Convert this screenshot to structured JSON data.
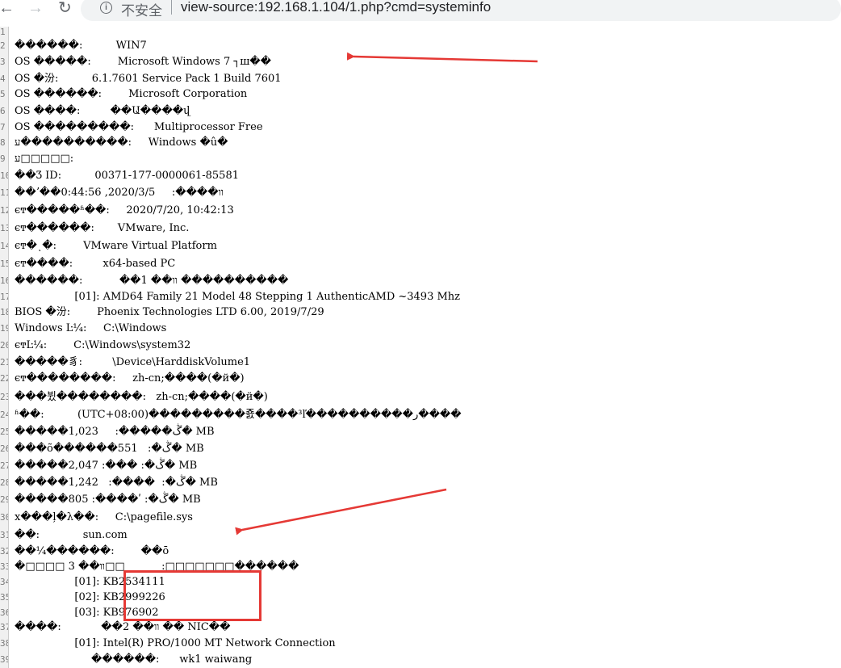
{
  "browser": {
    "back_icon": "back-arrow-icon",
    "forward_icon": "forward-arrow-icon",
    "reload_icon": "reload-icon",
    "security_icon": "info-icon",
    "security_label": "不安全",
    "url": "view-source:192.168.1.104/1.php?cmd=systeminfo"
  },
  "source_lines": [
    {
      "n": "1",
      "text": ""
    },
    {
      "n": "2",
      "text": "������:          WIN7"
    },
    {
      "n": "3",
      "text": "OS �����:        Microsoft Windows 7 ┐ш��"
    },
    {
      "n": "4",
      "text": "OS �汾:          6.1.7601 Service Pack 1 Build 7601"
    },
    {
      "n": "5",
      "text": "OS ������:        Microsoft Corporation"
    },
    {
      "n": "6",
      "text": "OS ����:         ��Ա����վ"
    },
    {
      "n": "7",
      "text": "OS ���������:      Multiprocessor Free"
    },
    {
      "n": "8",
      "text": "ע����������:     Windows �û�"
    },
    {
      "n": "9",
      "text": "ע□□□□□:"
    },
    {
      "n": "10",
      "text": "��Ʒ ID:          00371-177-0000061-85581"
    },
    {
      "n": "11",
      "text": "��ʼ��0:44:56 ,2020/3/5     :����װ"
    },
    {
      "n": "12",
      "text": "ϵͳ�����ʱ��:     2020/7/20, 10:42:13"
    },
    {
      "n": "13",
      "text": "ϵͳ������:       VMware, Inc."
    },
    {
      "n": "14",
      "text": "ϵͳ�ͺ�:        VMware Virtual Platform"
    },
    {
      "n": "15",
      "text": "ϵͳ����:         x64-based PC"
    },
    {
      "n": "16",
      "text": "������:           ��1 ��װ ����������"
    },
    {
      "n": "17",
      "text": "                  [01]: AMD64 Family 21 Model 48 Stepping 1 AuthenticAMD ~3493 Mhz"
    },
    {
      "n": "18",
      "text": "BIOS �汾:        Phoenix Technologies LTD 6.00, 2019/7/29"
    },
    {
      "n": "19",
      "text": "Windows Ŀ¼:     C:\\Windows"
    },
    {
      "n": "20",
      "text": "ϵͳĿ¼:        C:\\Windows\\system32"
    },
    {
      "n": "21",
      "text": "�����豸:         \\Device\\HarddiskVolume1"
    },
    {
      "n": "22",
      "text": "ϵͳ��������:     zh-cn;����(�й�)"
    },
    {
      "n": "23",
      "text": "���뷨��������:   zh-cn;����(�й�)"
    },
    {
      "n": "24",
      "text": "ʱ��:          (UTC+08:00)���������죬����³ľ����������ر����"
    },
    {
      "n": "25",
      "text": "�����1,023     :�����ڴ� MB"
    },
    {
      "n": "26",
      "text": "���õ������551   :�ڴ� MB"
    },
    {
      "n": "27",
      "text": "�����2,047 :��� :�ڴ� MB"
    },
    {
      "n": "28",
      "text": "�����1,242   :����  :�ڴ� MB"
    },
    {
      "n": "29",
      "text": "�����805 :����ʹ :�ڴ� MB"
    },
    {
      "n": "30",
      "text": "x���ļ�λ��:     C:\\pagefile.sys"
    },
    {
      "n": "31",
      "text": "��:             sun.com"
    },
    {
      "n": "32",
      "text": "��¼������:        ��ō"
    },
    {
      "n": "33",
      "text": "�□□□□ 3 ��װ□□           :□□□□□□□������"
    },
    {
      "n": "34",
      "text": "                  [01]: KB2534111"
    },
    {
      "n": "35",
      "text": "                  [02]: KB2999226"
    },
    {
      "n": "36",
      "text": "                  [03]: KB976902"
    },
    {
      "n": "37",
      "text": "����:            ��2 ��װ �� NIC��"
    },
    {
      "n": "38",
      "text": "                  [01]: Intel(R) PRO/1000 MT Network Connection"
    },
    {
      "n": "39",
      "text": "                       ������:      wk1 waiwang"
    }
  ],
  "annotations": {
    "color": "#e53935"
  }
}
